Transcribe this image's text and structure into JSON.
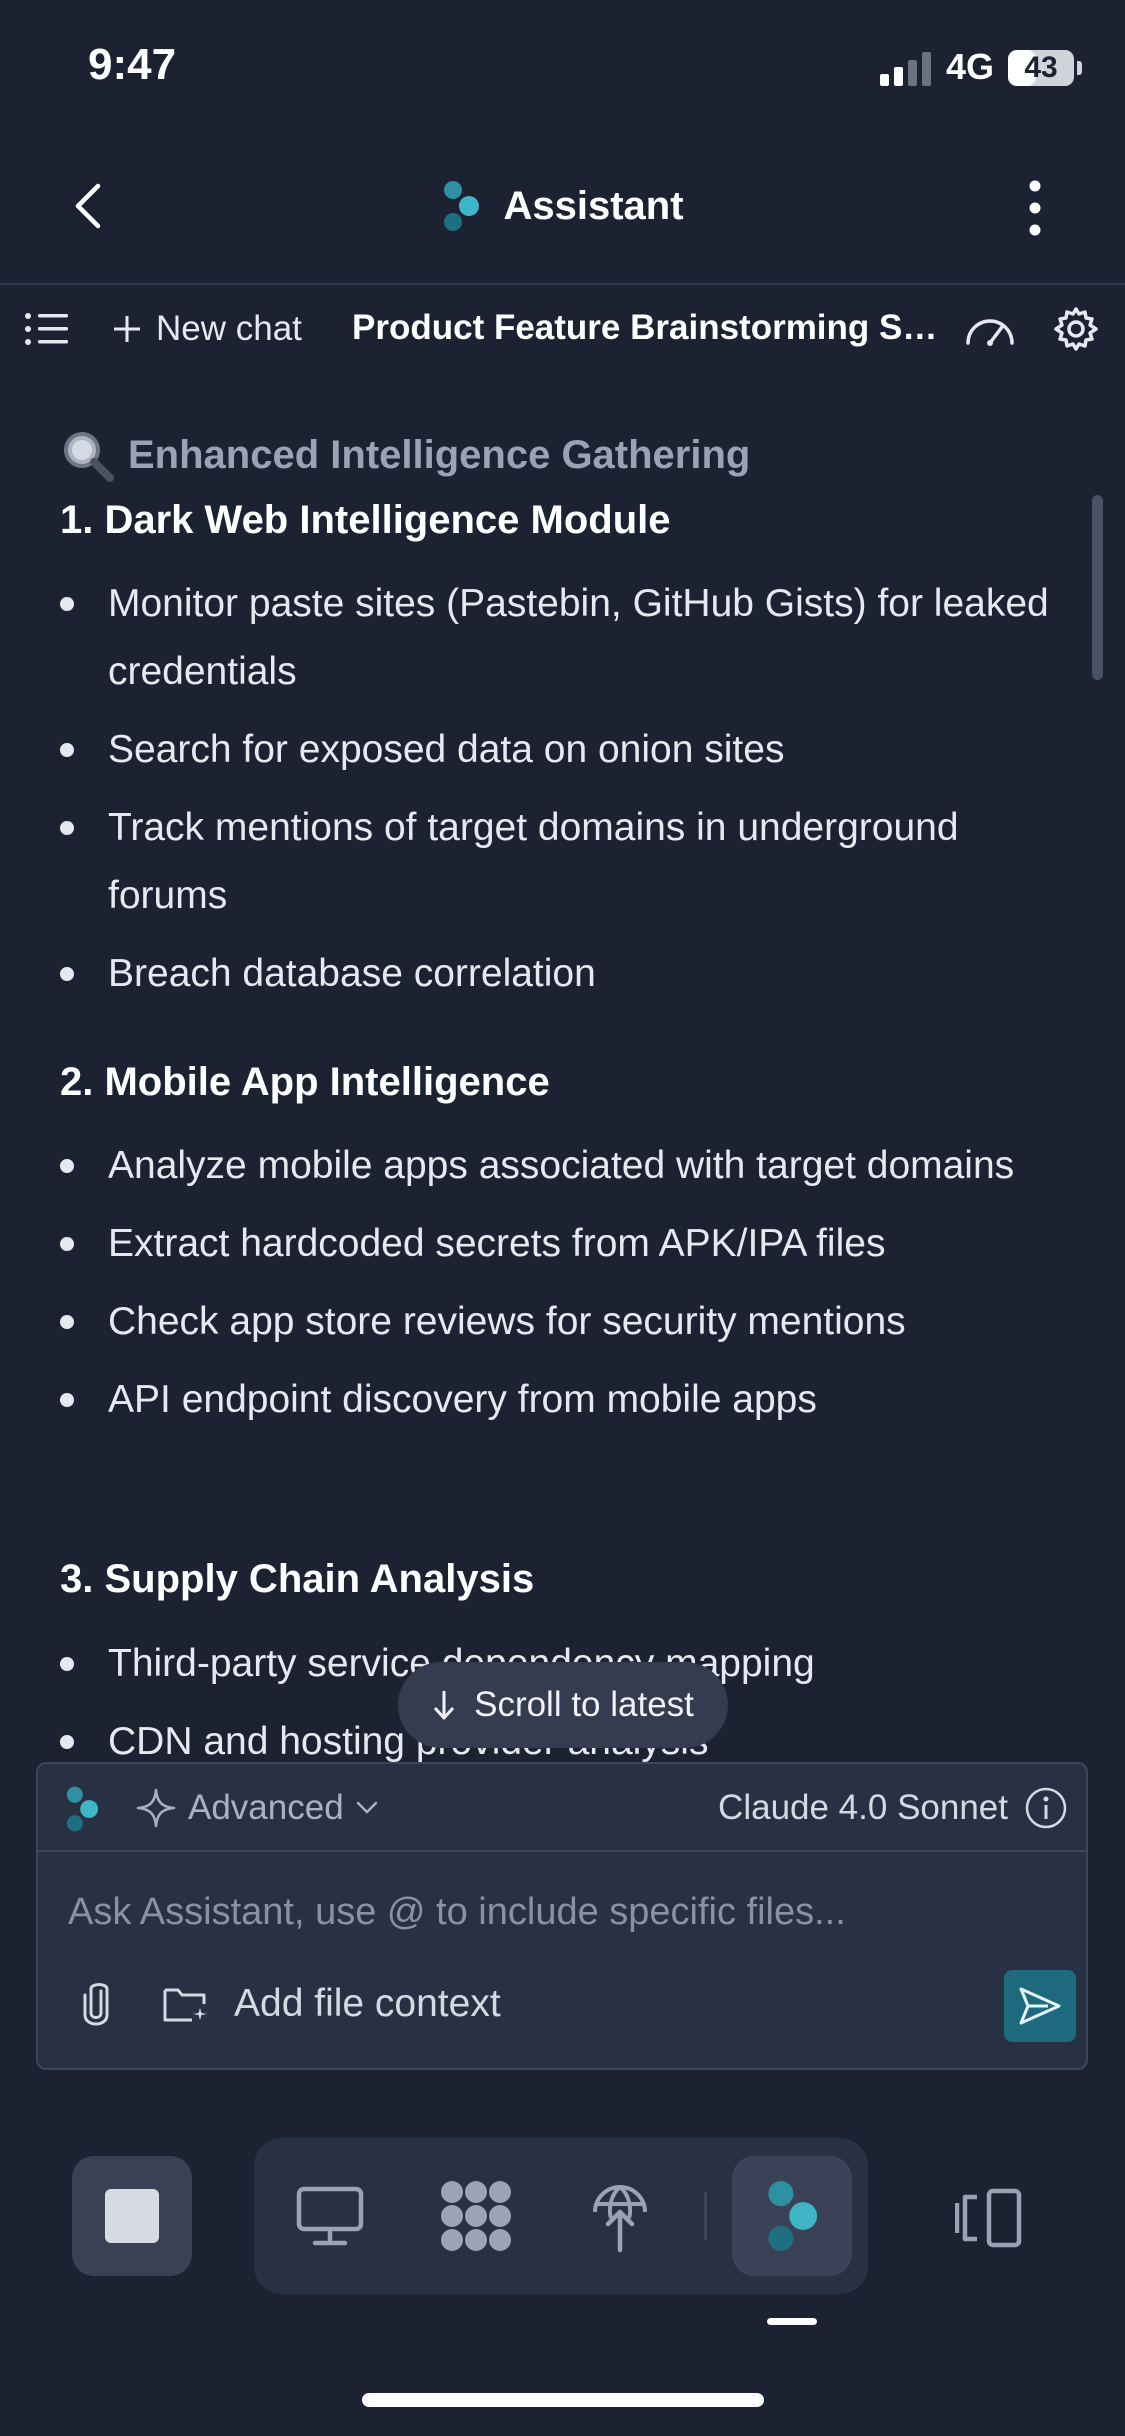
{
  "status_bar": {
    "time": "9:47",
    "network": "4G",
    "battery": "43",
    "battery_fraction": 0.43
  },
  "header": {
    "title": "Assistant"
  },
  "toolbar": {
    "new_chat_label": "New chat",
    "session_title": "Product Feature Brainstorming Se..."
  },
  "content": {
    "section_heading": "Enhanced Intelligence Gathering",
    "section_icon": "magnifying-glass-emoji",
    "modules": [
      {
        "title": "1. Dark Web Intelligence Module",
        "bullets": [
          "Monitor paste sites (Pastebin, GitHub Gists) for leaked credentials",
          "Search for exposed data on onion sites",
          "Track mentions of target domains in underground forums",
          "Breach database correlation"
        ]
      },
      {
        "title": "2. Mobile App Intelligence",
        "bullets": [
          "Analyze mobile apps associated with target domains",
          "Extract hardcoded secrets from APK/IPA files",
          "Check app store reviews for security mentions",
          "API endpoint discovery from mobile apps"
        ]
      },
      {
        "title": "3. Supply Chain Analysis",
        "bullets": [
          "Third-party service dependency mapping",
          "CDN and hosting provider analysis"
        ]
      }
    ]
  },
  "scroll_button": {
    "label": "Scroll to latest"
  },
  "input_panel": {
    "mode_label": "Advanced",
    "model_label": "Claude 4.0 Sonnet",
    "placeholder": "Ask Assistant, use @ to include specific files...",
    "value": "",
    "add_context_label": "Add file context"
  },
  "colors": {
    "background": "#1c2232",
    "panel": "#283043",
    "accent": "#3fb6c8",
    "send_button": "#1d6a7e"
  }
}
